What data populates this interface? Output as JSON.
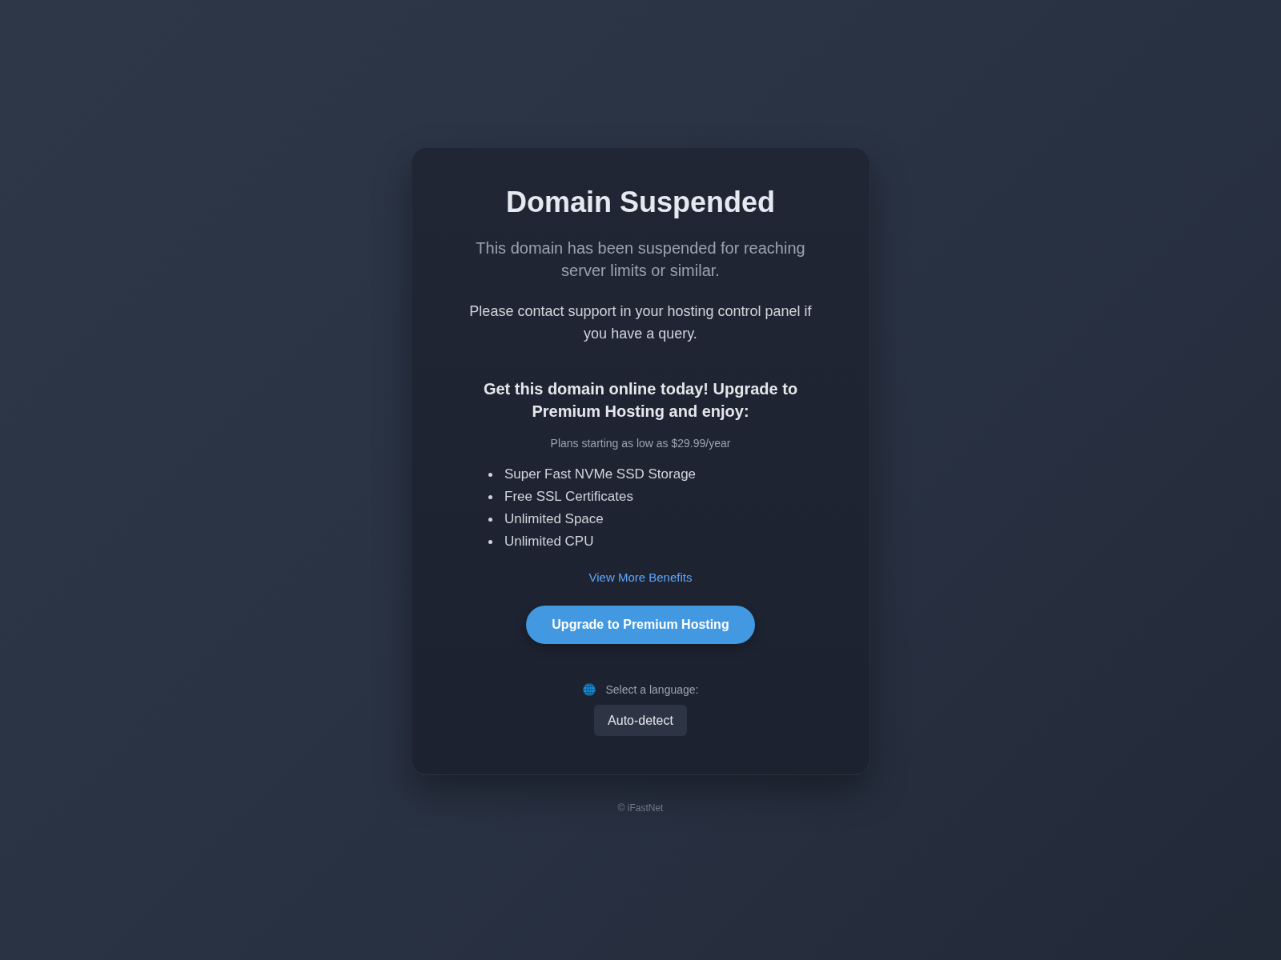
{
  "card": {
    "title": "Domain Suspended",
    "subtitle": "This domain has been suspended for reaching server limits or similar.",
    "message": "Please contact support in your hosting control panel if you have a query."
  },
  "promo": {
    "heading": "Get this domain online today! Upgrade to Premium Hosting and enjoy:",
    "price_note": "Plans starting as low as $29.99/year",
    "benefits": [
      "Super Fast NVMe SSD Storage",
      "Free SSL Certificates",
      "Unlimited Space",
      "Unlimited CPU"
    ],
    "link": "View More Benefits",
    "button": "Upgrade to Premium Hosting"
  },
  "language": {
    "label": "Select a language:",
    "value": "Auto-detect"
  },
  "footer": "© iFastNet"
}
